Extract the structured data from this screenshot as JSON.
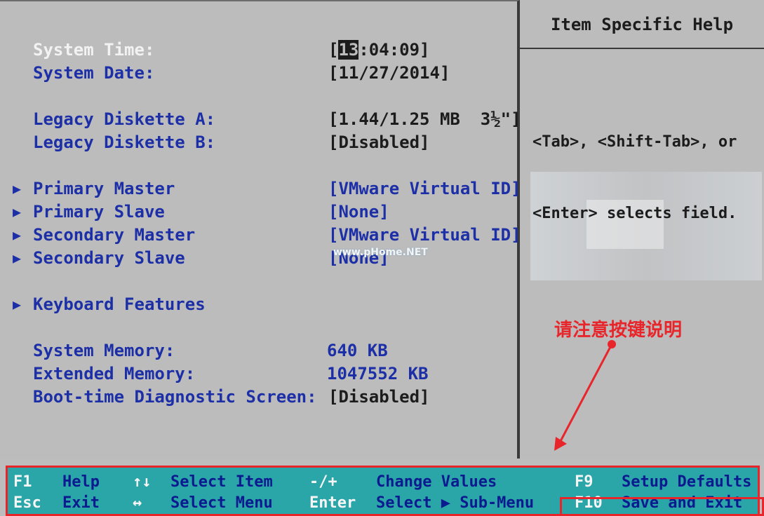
{
  "help_panel": {
    "title": "Item Specific Help",
    "line1": "<Tab>, <Shift-Tab>, or",
    "line2": "<Enter> selects field."
  },
  "main": {
    "system_time": {
      "label": "System Time:",
      "cursor_digits": "13",
      "rest": ":04:09]",
      "open": "["
    },
    "system_date": {
      "label": "System Date:",
      "value": "[11/27/2014]"
    },
    "legacy_a": {
      "label": "Legacy Diskette A:",
      "value": "[1.44/1.25 MB  3½\"]"
    },
    "legacy_b": {
      "label": "Legacy Diskette B:",
      "value": "[Disabled]"
    },
    "submenus": [
      {
        "label": "Primary Master",
        "value": "[VMware Virtual ID]"
      },
      {
        "label": "Primary Slave",
        "value": "[None]"
      },
      {
        "label": "Secondary Master",
        "value": "[VMware Virtual ID]"
      },
      {
        "label": "Secondary Slave",
        "value": "[None]"
      },
      {
        "label": "Keyboard Features",
        "value": ""
      }
    ],
    "system_memory": {
      "label": "System Memory:",
      "value": "640 KB"
    },
    "extended_memory": {
      "label": "Extended Memory:",
      "value": "1047552 KB"
    },
    "boot_diag": {
      "label": "Boot-time Diagnostic Screen:",
      "value": "[Disabled]"
    }
  },
  "watermark": "www.pHome.NET",
  "annotation": "请注意按键说明",
  "footer": {
    "row1": [
      {
        "key": "F1",
        "desc": "Help"
      },
      {
        "key": "↑↓",
        "desc": "Select Item"
      },
      {
        "key": "-/+",
        "desc": "Change Values"
      },
      {
        "key": "F9",
        "desc": "Setup Defaults"
      }
    ],
    "row2": [
      {
        "key": "Esc",
        "desc": "Exit"
      },
      {
        "key": "↔",
        "desc": "Select Menu"
      },
      {
        "key": "Enter",
        "desc": "Select ▶ Sub-Menu"
      },
      {
        "key": "F10",
        "desc": "Save and Exit"
      }
    ]
  },
  "colors": {
    "label_blue": "#1c2fa6",
    "footer_teal": "#2aa5a8",
    "highlight_red": "#e8252b"
  }
}
